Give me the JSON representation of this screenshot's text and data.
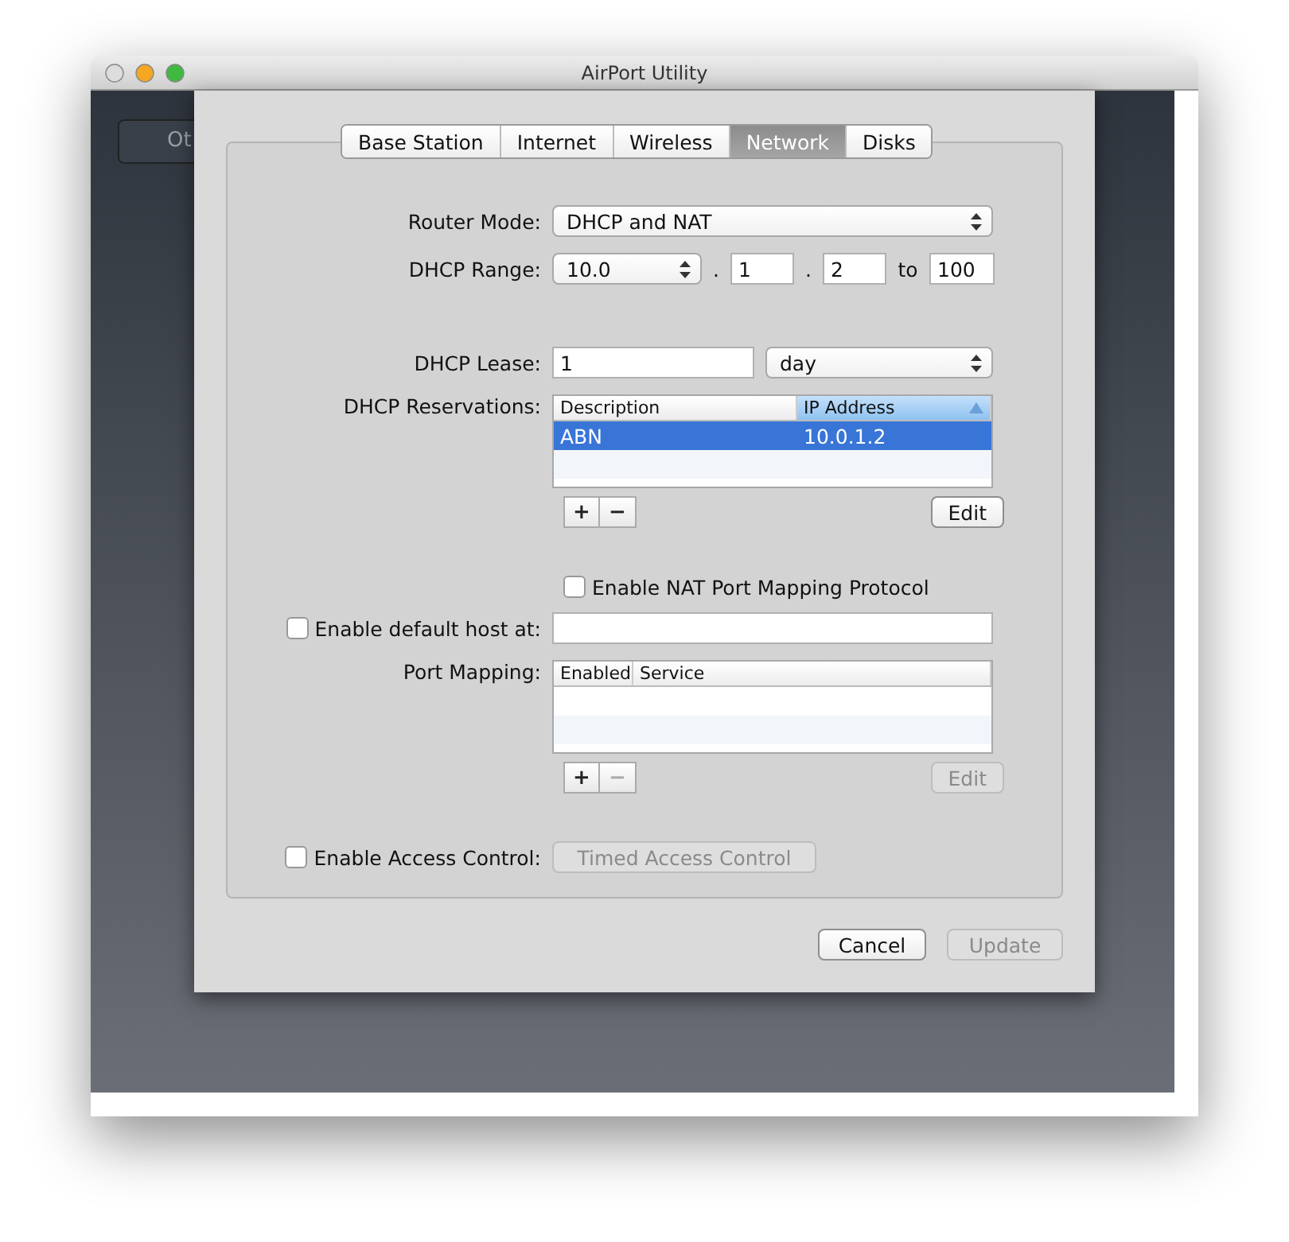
{
  "window": {
    "title": "AirPort Utility"
  },
  "background_button": {
    "label": "Ot"
  },
  "tabs": [
    {
      "label": "Base Station",
      "selected": false
    },
    {
      "label": "Internet",
      "selected": false
    },
    {
      "label": "Wireless",
      "selected": false
    },
    {
      "label": "Network",
      "selected": true
    },
    {
      "label": "Disks",
      "selected": false
    }
  ],
  "router_mode": {
    "label": "Router Mode:",
    "value": "DHCP and NAT"
  },
  "dhcp_range": {
    "label": "DHCP Range:",
    "prefix": "10.0",
    "dot_1": ".",
    "octet": "1",
    "dot_2": ".",
    "start": "2",
    "to": "to",
    "end": "100"
  },
  "dhcp_lease": {
    "label": "DHCP Lease:",
    "value": "1",
    "unit": "day"
  },
  "reservations": {
    "label": "DHCP Reservations:",
    "columns": [
      {
        "label": "Description",
        "sorted": false
      },
      {
        "label": "IP Address",
        "sorted": true
      }
    ],
    "rows": [
      {
        "cells": [
          "ABN",
          "10.0.1.2"
        ],
        "selected": true
      }
    ],
    "add": {
      "label": "+",
      "disabled": false
    },
    "remove": {
      "label": "−",
      "disabled": false
    },
    "edit": {
      "label": "Edit",
      "disabled": false
    }
  },
  "nat_pmp": {
    "label": "Enable NAT Port Mapping Protocol",
    "checked": false
  },
  "default_host": {
    "label": "Enable default host at:",
    "checked": false
  },
  "port_mapping": {
    "label": "Port Mapping:",
    "columns": [
      {
        "label": "Enabled",
        "sorted": false
      },
      {
        "label": "Service",
        "sorted": false
      }
    ],
    "add": {
      "label": "+",
      "disabled": false
    },
    "remove": {
      "label": "−",
      "disabled": true
    },
    "edit": {
      "label": "Edit",
      "disabled": true
    }
  },
  "access_control": {
    "label": "Enable Access Control:",
    "checked": false,
    "button": {
      "label": "Timed Access Control",
      "disabled": true
    }
  },
  "buttons": [
    {
      "label": "Cancel",
      "disabled": false
    },
    {
      "label": "Update",
      "disabled": true
    }
  ]
}
